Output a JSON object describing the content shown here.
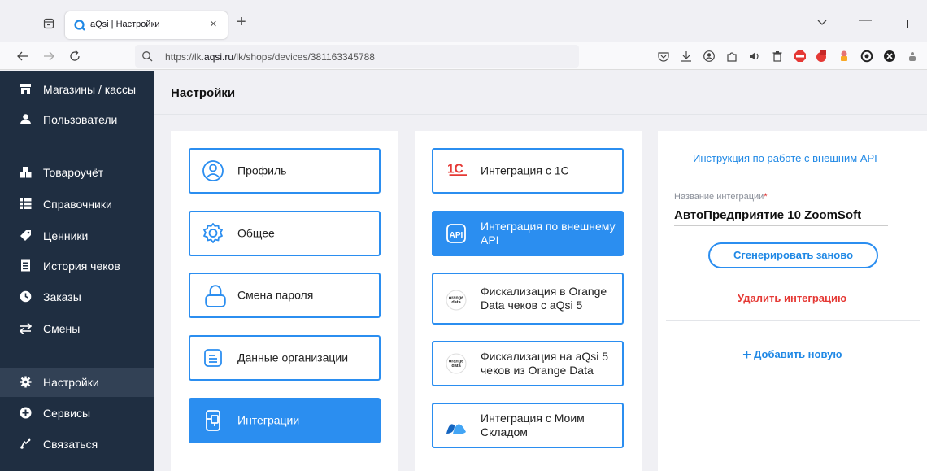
{
  "browser": {
    "tab_title": "aQsi | Настройки",
    "tab_close": "×",
    "new_tab": "+",
    "minimize": "—",
    "url_prefix": "https://lk.",
    "url_domain": "aqsi.ru",
    "url_path": "/lk/shops/devices/381163345788"
  },
  "sidebar": {
    "items": [
      {
        "label": "Магазины / кассы",
        "icon": "store-icon"
      },
      {
        "label": "Пользователи",
        "icon": "user-icon"
      },
      {
        "label": "Товароучёт",
        "icon": "boxes-icon"
      },
      {
        "label": "Справочники",
        "icon": "list-icon"
      },
      {
        "label": "Ценники",
        "icon": "tag-icon"
      },
      {
        "label": "История чеков",
        "icon": "receipt-icon"
      },
      {
        "label": "Заказы",
        "icon": "clock-icon"
      },
      {
        "label": "Смены",
        "icon": "swap-icon"
      },
      {
        "label": "Настройки",
        "icon": "gear-icon",
        "active": true
      },
      {
        "label": "Сервисы",
        "icon": "plus-circle-icon"
      },
      {
        "label": "Связаться",
        "icon": "phone-icon"
      }
    ]
  },
  "page": {
    "title": "Настройки"
  },
  "settings_menu": {
    "items": [
      {
        "label": "Профиль",
        "icon": "profile-icon"
      },
      {
        "label": "Общее",
        "icon": "gear-icon"
      },
      {
        "label": "Смена пароля",
        "icon": "lock-icon"
      },
      {
        "label": "Данные организации",
        "icon": "document-icon"
      },
      {
        "label": "Интеграции",
        "icon": "integration-icon",
        "active": true
      }
    ]
  },
  "integrations": {
    "items": [
      {
        "label": "Интеграция с 1С",
        "icon": "1c-logo-icon"
      },
      {
        "label": "Интеграция по внешнему API",
        "icon": "api-icon",
        "active": true
      },
      {
        "label": "Фискализация в Orange Data чеков с aQsi 5",
        "icon": "orange-data-logo-icon"
      },
      {
        "label": "Фискализация на aQsi 5 чеков из Orange Data",
        "icon": "orange-data-logo-icon"
      },
      {
        "label": "Интеграция с Моим Складом",
        "icon": "moysklad-logo-icon"
      }
    ],
    "logo_1c": "1С",
    "logo_api": "API",
    "logo_orange_top": "orange",
    "logo_orange_bottom": "data"
  },
  "detail": {
    "api_instructions_link": "Инструкция по работе с внешним API",
    "field_label": "Название интеграции",
    "required_mark": "*",
    "field_value": "АвтоПредприятие 10 ZoomSoft",
    "regenerate_button": "Сгенерировать заново",
    "delete_link": "Удалить интеграцию",
    "add_new_plus": "+",
    "add_new_link": "Добавить новую"
  },
  "colors": {
    "sidebar_bg": "#1f2e41",
    "sidebar_active": "#324155",
    "accent_blue": "#2b8ef0",
    "danger_red": "#e53935"
  }
}
